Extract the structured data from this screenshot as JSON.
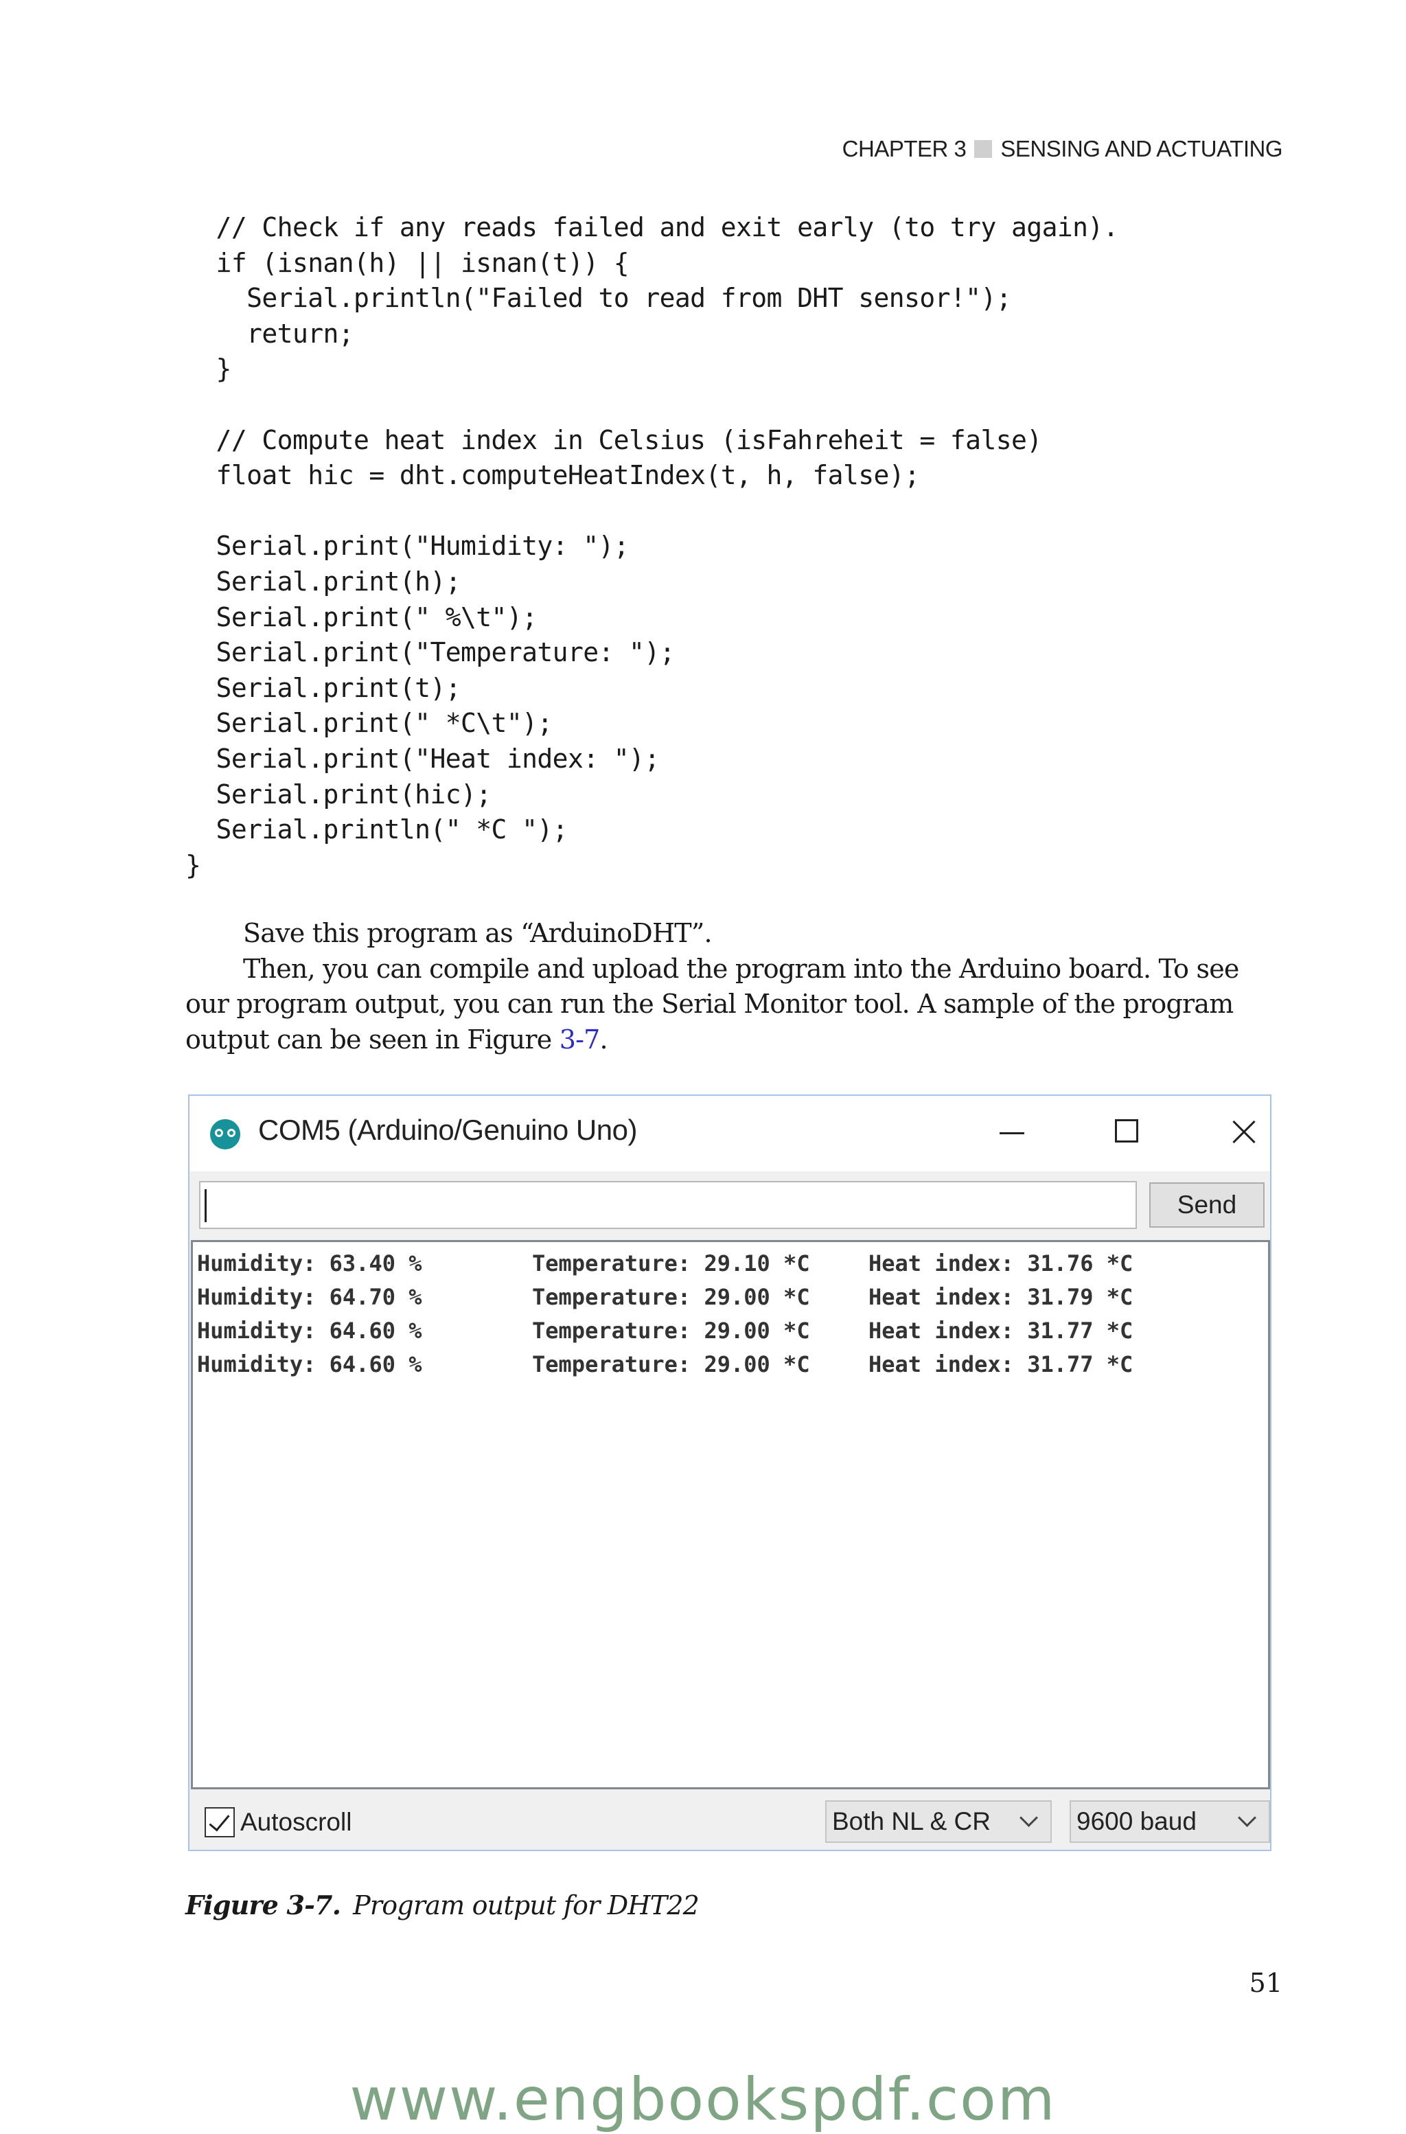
{
  "header": {
    "chapter": "CHAPTER 3",
    "section": "SENSING AND ACTUATING"
  },
  "code_lines": [
    "  // Check if any reads failed and exit early (to try again).",
    "  if (isnan(h) || isnan(t)) {",
    "    Serial.println(\"Failed to read from DHT sensor!\");",
    "    return;",
    "  }",
    "",
    "  // Compute heat index in Celsius (isFahreheit = false)",
    "  float hic = dht.computeHeatIndex(t, h, false);",
    "",
    "  Serial.print(\"Humidity: \");",
    "  Serial.print(h);",
    "  Serial.print(\" %\\t\");",
    "  Serial.print(\"Temperature: \");",
    "  Serial.print(t);",
    "  Serial.print(\" *C\\t\");",
    "  Serial.print(\"Heat index: \");",
    "  Serial.print(hic);",
    "  Serial.println(\" *C \");",
    "}"
  ],
  "prose": {
    "p1": "Save this program as “ArduinoDHT”.",
    "p2_before": "Then, you can compile and upload the program into the Arduino board. To see our program output, you can run the Serial Monitor tool. A sample of the program output can be seen in Figure ",
    "p2_link": "3-7",
    "p2_after": "."
  },
  "serial_monitor": {
    "title": "COM5 (Arduino/Genuino Uno)",
    "input_value": "",
    "send_label": "Send",
    "rows": [
      {
        "humidity": "Humidity: 63.40 %",
        "temperature": "Temperature: 29.10 *C",
        "heat_index": "Heat index: 31.76 *C"
      },
      {
        "humidity": "Humidity: 64.70 %",
        "temperature": "Temperature: 29.00 *C",
        "heat_index": "Heat index: 31.79 *C"
      },
      {
        "humidity": "Humidity: 64.60 %",
        "temperature": "Temperature: 29.00 *C",
        "heat_index": "Heat index: 31.77 *C"
      },
      {
        "humidity": "Humidity: 64.60 %",
        "temperature": "Temperature: 29.00 *C",
        "heat_index": "Heat index: 31.77 *C"
      }
    ],
    "autoscroll_label": "Autoscroll",
    "autoscroll_checked": true,
    "line_ending": "Both NL & CR",
    "baud_rate": "9600 baud"
  },
  "caption": {
    "label": "Figure 3-7.",
    "text": "Program output for DHT22"
  },
  "page_number": "51",
  "watermark": "www.engbookspdf.com"
}
